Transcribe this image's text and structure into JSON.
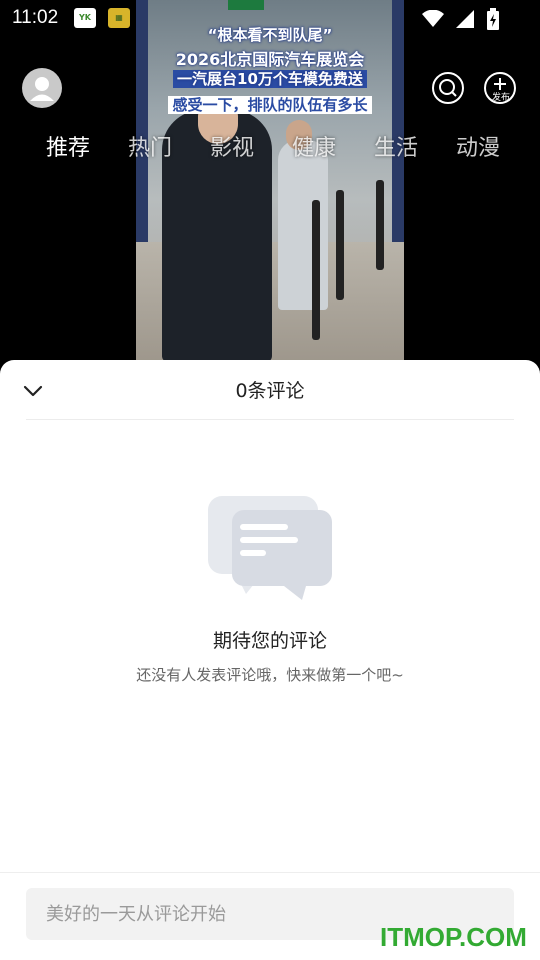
{
  "status_bar": {
    "time": "11:02",
    "icons": [
      "wifi-icon",
      "signal-icon",
      "battery-icon"
    ]
  },
  "video": {
    "caption_line1": "“根本看不到队尾”",
    "caption_line2": "2026北京国际汽车展览会",
    "caption_line3": "一汽展台10万个车模免费送",
    "caption_line4": "感受一下，排队的队伍有多长"
  },
  "top_bar": {
    "publish_label": "发布"
  },
  "tabs": [
    {
      "label": "推荐"
    },
    {
      "label": "热门"
    },
    {
      "label": "影视"
    },
    {
      "label": "健康"
    },
    {
      "label": "生活"
    },
    {
      "label": "动漫"
    }
  ],
  "comments": {
    "title": "0条评论",
    "empty_title": "期待您的评论",
    "empty_subtitle": "还没有人发表评论哦，快来做第一个吧~",
    "input_placeholder": "美好的一天从评论开始"
  },
  "watermark": "ITMOP.COM",
  "colors": {
    "watermark": "#33aa33",
    "sheet_bg": "#ffffff",
    "input_bg": "#f2f2f2"
  }
}
